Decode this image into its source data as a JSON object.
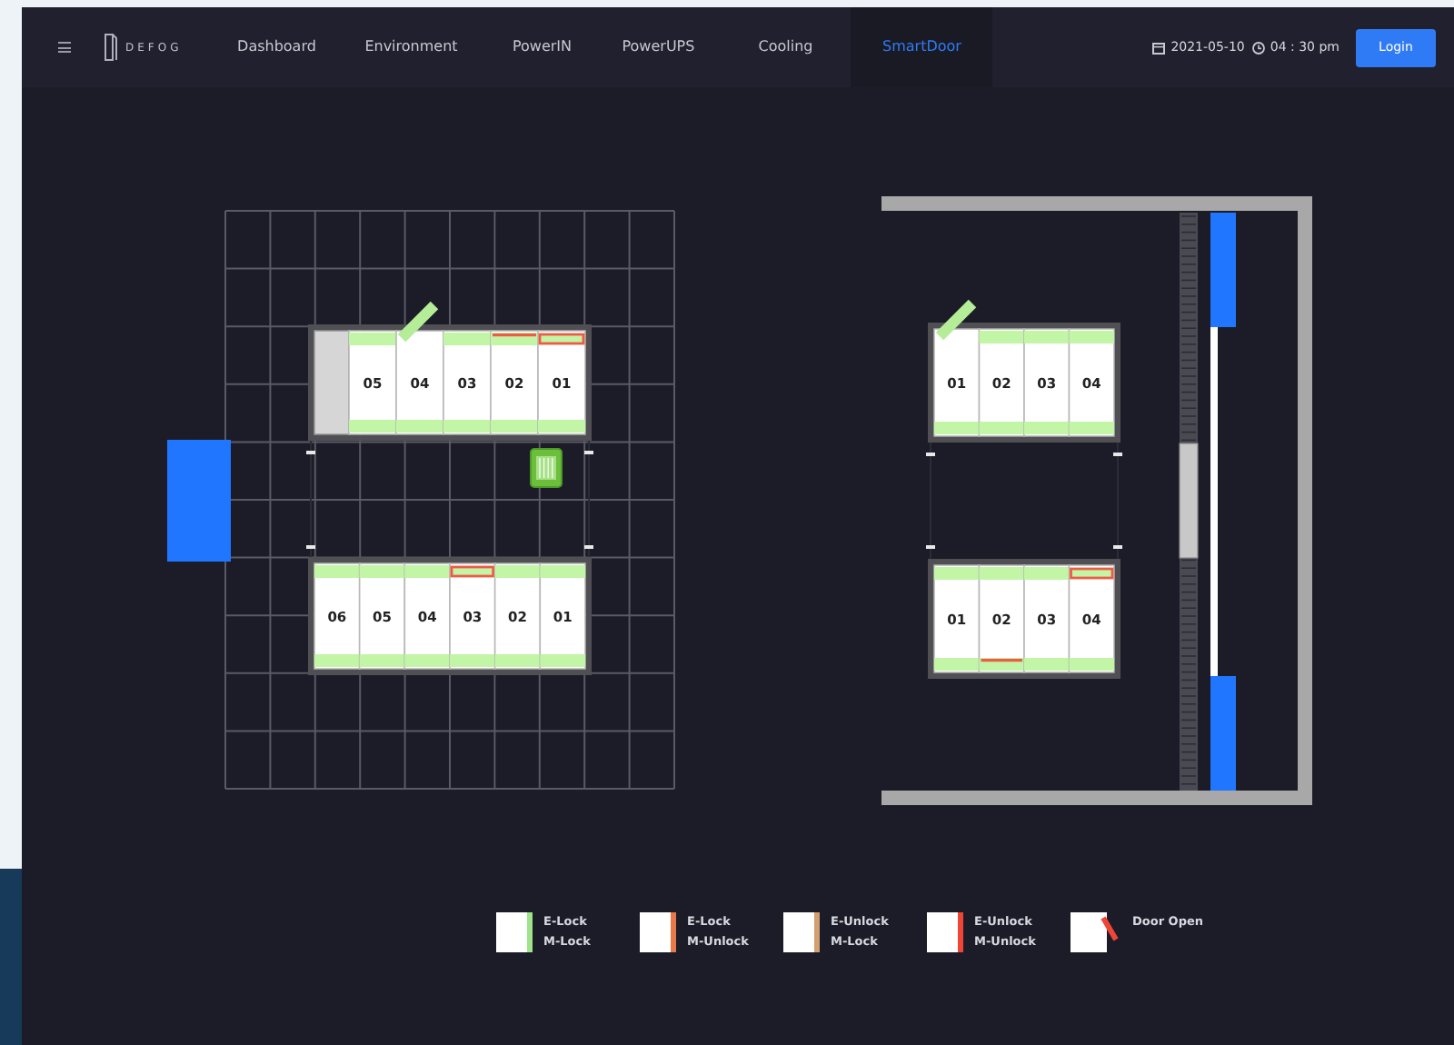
{
  "navbar": {
    "logo": "DEFOG",
    "tabs": [
      {
        "label": "Dashboard",
        "selected": false
      },
      {
        "label": "Environment",
        "selected": false
      },
      {
        "label": "PowerIN",
        "selected": false
      },
      {
        "label": "PowerUPS",
        "selected": false
      },
      {
        "label": "Cooling",
        "selected": false
      },
      {
        "label": "SmartDoor",
        "selected": true
      }
    ],
    "date": "2021-05-10",
    "time": "04 : 30 pm",
    "login": "Login"
  },
  "left_room": {
    "pods": [
      {
        "racks": [
          {
            "kind": "empty"
          },
          {
            "kind": "rack",
            "label": "05",
            "top_open": false,
            "top_line": false,
            "top_box": false,
            "bottom_line": false
          },
          {
            "kind": "rack",
            "label": "04",
            "top_open": true,
            "top_line": false,
            "top_box": false,
            "bottom_line": false
          },
          {
            "kind": "rack",
            "label": "03",
            "top_open": false,
            "top_line": false,
            "top_box": false,
            "bottom_line": false
          },
          {
            "kind": "rack",
            "label": "02",
            "top_open": false,
            "top_line": true,
            "top_box": false,
            "bottom_line": false
          },
          {
            "kind": "rack",
            "label": "01",
            "top_open": false,
            "top_line": false,
            "top_box": true,
            "bottom_line": false
          }
        ]
      },
      {
        "racks": [
          {
            "kind": "rack",
            "label": "06",
            "top_open": false,
            "top_line": false,
            "top_box": false,
            "bottom_line": false
          },
          {
            "kind": "rack",
            "label": "05",
            "top_open": false,
            "top_line": false,
            "top_box": false,
            "bottom_line": false
          },
          {
            "kind": "rack",
            "label": "04",
            "top_open": false,
            "top_line": false,
            "top_box": false,
            "bottom_line": false
          },
          {
            "kind": "rack",
            "label": "03",
            "top_open": false,
            "top_line": false,
            "top_box": true,
            "bottom_line": false
          },
          {
            "kind": "rack",
            "label": "02",
            "top_open": false,
            "top_line": false,
            "top_box": false,
            "bottom_line": false
          },
          {
            "kind": "rack",
            "label": "01",
            "top_open": false,
            "top_line": false,
            "top_box": false,
            "bottom_line": false
          }
        ]
      }
    ]
  },
  "right_room": {
    "pods": [
      {
        "racks": [
          {
            "kind": "rack",
            "label": "01",
            "top_open": true,
            "top_line": false,
            "top_box": false,
            "bottom_line": false
          },
          {
            "kind": "rack",
            "label": "02",
            "top_open": false,
            "top_line": false,
            "top_box": false,
            "bottom_line": false
          },
          {
            "kind": "rack",
            "label": "03",
            "top_open": false,
            "top_line": false,
            "top_box": false,
            "bottom_line": false
          },
          {
            "kind": "rack",
            "label": "04",
            "top_open": false,
            "top_line": false,
            "top_box": false,
            "bottom_line": false
          }
        ]
      },
      {
        "racks": [
          {
            "kind": "rack",
            "label": "01",
            "top_open": false,
            "top_line": false,
            "top_box": false,
            "bottom_line": false
          },
          {
            "kind": "rack",
            "label": "02",
            "top_open": false,
            "top_line": false,
            "top_box": false,
            "bottom_line": true
          },
          {
            "kind": "rack",
            "label": "03",
            "top_open": false,
            "top_line": false,
            "top_box": false,
            "bottom_line": false
          },
          {
            "kind": "rack",
            "label": "04",
            "top_open": false,
            "top_line": false,
            "top_box": true,
            "bottom_line": false
          }
        ]
      }
    ]
  },
  "legend": [
    {
      "kind": "elock_mlock",
      "lines": [
        "E-Lock",
        "M-Lock"
      ]
    },
    {
      "kind": "elock_munlock",
      "lines": [
        "E-Lock",
        "M-Unlock"
      ]
    },
    {
      "kind": "eunlock_mlock",
      "lines": [
        "E-Unlock",
        "M-Lock"
      ]
    },
    {
      "kind": "eunlock_munlock",
      "lines": [
        "E-Unlock",
        "M-Unlock"
      ]
    },
    {
      "kind": "door_open",
      "lines": [
        "Door Open"
      ]
    }
  ]
}
